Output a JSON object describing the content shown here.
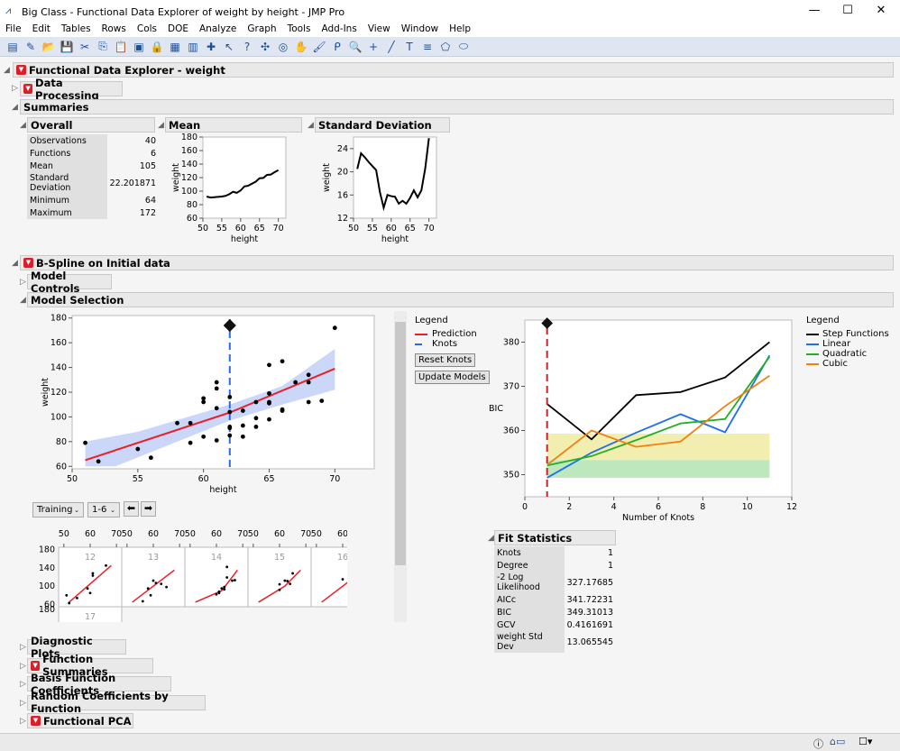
{
  "window": {
    "title": "Big Class - Functional Data Explorer of weight by height - JMP Pro",
    "minimize": "—",
    "maximize": "☐",
    "close": "✕"
  },
  "menu": [
    "File",
    "Edit",
    "Tables",
    "Rows",
    "Cols",
    "DOE",
    "Analyze",
    "Graph",
    "Tools",
    "Add-Ins",
    "View",
    "Window",
    "Help"
  ],
  "toolbar_icons": [
    "new-data-table",
    "new-script",
    "open",
    "save",
    "cut",
    "copy",
    "paste",
    "journal",
    "lock",
    "data-table",
    "bars",
    "add",
    "arrow",
    "help",
    "crosshair",
    "target",
    "hand",
    "brush",
    "lasso",
    "magnifier",
    "plus",
    "line",
    "text",
    "list",
    "shape",
    "ellipse"
  ],
  "report": {
    "title": "Functional Data Explorer - weight",
    "data_processing": "Data Processing",
    "summaries": "Summaries",
    "overall": {
      "title": "Overall",
      "rows": [
        [
          "Observations",
          "40"
        ],
        [
          "Functions",
          "6"
        ],
        [
          "Mean",
          "105"
        ],
        [
          "Standard Deviation",
          "22.201871"
        ],
        [
          "Minimum",
          "64"
        ],
        [
          "Maximum",
          "172"
        ]
      ]
    },
    "mean_title": "Mean",
    "sd_title": "Standard Deviation",
    "bspline": "B-Spline on Initial data",
    "model_controls": "Model Controls",
    "model_selection": "Model Selection",
    "legend": {
      "title": "Legend",
      "prediction": "Prediction",
      "knots": "Knots"
    },
    "reset_knots": "Reset Knots",
    "update_models": "Update Models",
    "training": "Training",
    "range": "1-6",
    "bic_legend": {
      "title": "Legend",
      "items": [
        "Step Functions",
        "Linear",
        "Quadratic",
        "Cubic"
      ]
    },
    "fit_stats": {
      "title": "Fit Statistics",
      "rows": [
        [
          "Knots",
          "1"
        ],
        [
          "Degree",
          "1"
        ],
        [
          "-2 Log Likelihood",
          "327.17685"
        ],
        [
          "AICc",
          "341.72231"
        ],
        [
          "BIC",
          "349.31013"
        ],
        [
          "GCV",
          "0.4161691"
        ],
        [
          "weight Std Dev",
          "13.065545"
        ]
      ]
    },
    "sections": [
      "Diagnostic Plots",
      "Function Summaries",
      "Basis Function Coefficients",
      "Random Coefficients by Function",
      "Functional PCA"
    ]
  },
  "colors": {
    "prediction": "#e8202a",
    "knots": "#2a6ae8",
    "band": "#c4d3f8",
    "step": "#000000",
    "linear": "#1f6fe8",
    "quadratic": "#22b022",
    "cubic": "#f08010"
  },
  "chart_data": [
    {
      "type": "line",
      "title": "Mean",
      "xlabel": "height",
      "ylabel": "weight",
      "xlim": [
        50,
        72
      ],
      "ylim": [
        60,
        180
      ],
      "xticks": [
        50,
        55,
        60,
        65,
        70
      ],
      "yticks": [
        60,
        80,
        100,
        120,
        140,
        160,
        180
      ],
      "x": [
        51,
        52,
        53,
        54,
        55,
        56,
        57,
        58,
        59,
        60,
        61,
        62,
        63,
        64,
        65,
        66,
        67,
        68,
        69,
        70
      ],
      "values": [
        92,
        90.5,
        91,
        91.5,
        92,
        93,
        95.5,
        99,
        97.5,
        101,
        107,
        108,
        111,
        114,
        119,
        119.5,
        124,
        124.5,
        128,
        131
      ]
    },
    {
      "type": "line",
      "title": "Standard Deviation",
      "xlabel": "height",
      "ylabel": "weight",
      "xlim": [
        50,
        72
      ],
      "ylim": [
        12,
        26
      ],
      "xticks": [
        50,
        55,
        60,
        65,
        70
      ],
      "yticks": [
        12,
        16,
        20,
        24
      ],
      "x": [
        51,
        52,
        53,
        54,
        55,
        56,
        57,
        58,
        59,
        60,
        61,
        62,
        63,
        64,
        65,
        66,
        67,
        68,
        69,
        70
      ],
      "values": [
        20.5,
        23.2,
        22.5,
        21.7,
        21,
        20.3,
        16.5,
        13.8,
        16,
        15.8,
        15.7,
        14.5,
        15,
        14.5,
        15.5,
        16.8,
        15.6,
        16.8,
        20.5,
        25.8
      ]
    },
    {
      "type": "scatter",
      "title": "Model Selection",
      "xlabel": "height",
      "ylabel": "weight",
      "xlim": [
        50,
        73
      ],
      "ylim": [
        58,
        182
      ],
      "xticks": [
        50,
        55,
        60,
        65,
        70
      ],
      "yticks": [
        60,
        80,
        100,
        120,
        140,
        160,
        180
      ],
      "knot": 62,
      "points": [
        [
          51,
          79
        ],
        [
          52,
          64
        ],
        [
          55,
          74
        ],
        [
          56,
          67
        ],
        [
          58,
          95
        ],
        [
          59,
          95
        ],
        [
          59,
          79
        ],
        [
          60,
          84
        ],
        [
          60,
          115
        ],
        [
          60,
          112
        ],
        [
          61,
          128
        ],
        [
          61,
          123
        ],
        [
          61,
          107
        ],
        [
          61,
          81
        ],
        [
          62,
          116
        ],
        [
          62,
          104
        ],
        [
          62,
          91
        ],
        [
          62,
          92
        ],
        [
          62,
          85
        ],
        [
          63,
          105
        ],
        [
          63,
          93
        ],
        [
          63,
          84
        ],
        [
          64,
          112
        ],
        [
          64,
          99
        ],
        [
          64,
          92
        ],
        [
          65,
          142
        ],
        [
          65,
          119
        ],
        [
          65,
          112
        ],
        [
          65,
          111
        ],
        [
          65,
          98
        ],
        [
          66,
          145
        ],
        [
          66,
          106
        ],
        [
          66,
          105
        ],
        [
          67,
          128
        ],
        [
          68,
          134
        ],
        [
          68,
          128
        ],
        [
          68,
          112
        ],
        [
          69,
          113
        ],
        [
          70,
          172
        ]
      ],
      "prediction": [
        [
          51,
          65
        ],
        [
          62,
          103.5
        ],
        [
          70,
          139
        ]
      ],
      "band_upper": [
        [
          51,
          80
        ],
        [
          55,
          88
        ],
        [
          62,
          110
        ],
        [
          66,
          125
        ],
        [
          70,
          155
        ]
      ],
      "band_lower": [
        [
          51,
          60
        ],
        [
          53.3,
          60
        ],
        [
          62,
          97
        ],
        [
          66,
          110
        ],
        [
          70,
          122
        ]
      ]
    },
    {
      "type": "line",
      "xlabel": "Number of Knots",
      "ylabel": "BIC",
      "xlim": [
        0,
        12
      ],
      "ylim": [
        345,
        385
      ],
      "xticks": [
        0,
        2,
        4,
        6,
        8,
        10,
        12
      ],
      "yticks": [
        350,
        360,
        370,
        380
      ],
      "selected_knots": 1,
      "x": [
        1,
        3,
        5,
        7,
        9,
        11
      ],
      "series": [
        {
          "name": "Step Functions",
          "values": [
            366,
            358,
            368,
            368.7,
            372,
            380
          ]
        },
        {
          "name": "Linear",
          "values": [
            349.3,
            355,
            359.5,
            363.7,
            359.6,
            377
          ]
        },
        {
          "name": "Quadratic",
          "values": [
            352.1,
            354.2,
            357.8,
            361.6,
            362.6,
            376.7
          ]
        },
        {
          "name": "Cubic",
          "values": [
            352.2,
            360,
            356.3,
            357.5,
            365.5,
            372.4
          ]
        }
      ],
      "bands": [
        {
          "from": 353.3,
          "to": 359.3,
          "color": "#f2eeb0"
        },
        {
          "from": 349.3,
          "to": 353.3,
          "color": "#bde8bd"
        }
      ]
    },
    {
      "type": "scatter",
      "title": "Functions",
      "panels": [
        "12",
        "13",
        "14",
        "15",
        "16",
        "17"
      ],
      "xticks": [
        50,
        60,
        70
      ],
      "yticks": [
        60,
        100,
        140,
        180
      ]
    }
  ]
}
